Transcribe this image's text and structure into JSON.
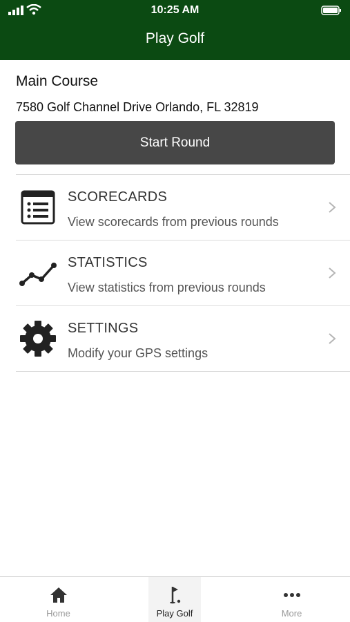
{
  "status_bar": {
    "time": "10:25 AM"
  },
  "header": {
    "title": "Play Golf"
  },
  "course": {
    "name": "Main Course",
    "address": "7580 Golf Channel Drive Orlando, FL 32819",
    "start_label": "Start Round"
  },
  "menu": [
    {
      "title": "SCORECARDS",
      "subtitle": "View scorecards from previous rounds",
      "icon": "scorecard-icon"
    },
    {
      "title": "STATISTICS",
      "subtitle": "View statistics from previous rounds",
      "icon": "statistics-icon"
    },
    {
      "title": "SETTINGS",
      "subtitle": "Modify your GPS settings",
      "icon": "gear-icon"
    }
  ],
  "tabs": [
    {
      "label": "Home",
      "icon": "home-icon",
      "active": false
    },
    {
      "label": "Play Golf",
      "icon": "golf-flag-icon",
      "active": true
    },
    {
      "label": "More",
      "icon": "more-dots-icon",
      "active": false
    }
  ],
  "colors": {
    "header_bg": "#0b4a12",
    "button_bg": "#474747"
  }
}
